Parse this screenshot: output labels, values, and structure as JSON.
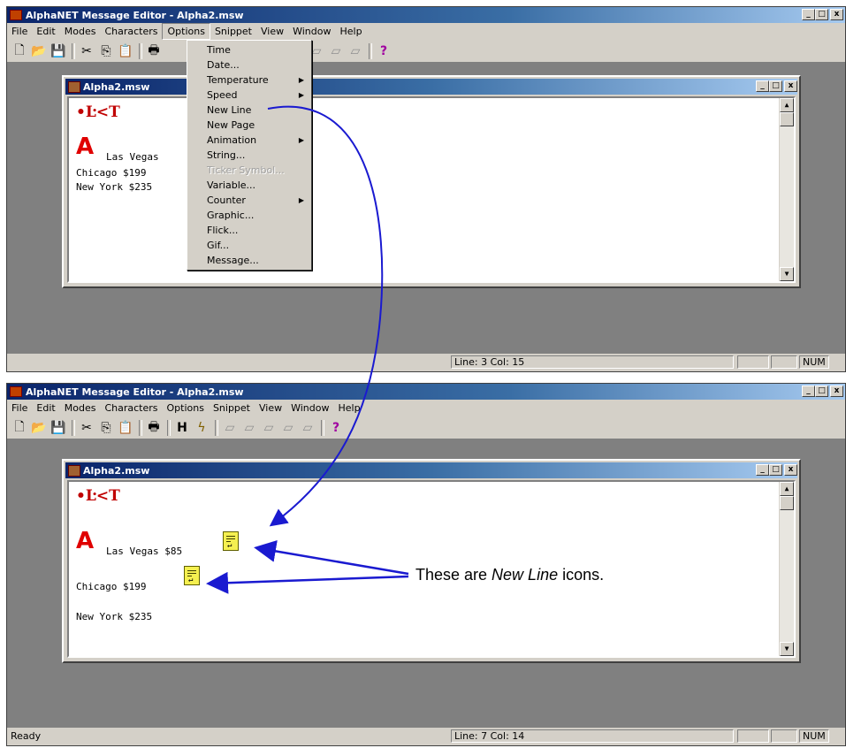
{
  "top_window": {
    "title": "AlphaNET Message Editor - Alpha2.msw",
    "controls": [
      "_",
      "□",
      "x"
    ],
    "menu": [
      "File",
      "Edit",
      "Modes",
      "Characters",
      "Options",
      "Snippet",
      "View",
      "Window",
      "Help"
    ],
    "open_menu": "Options",
    "child_title": "Alpha2.msw",
    "logo": "•Ŀ<T",
    "big_a": "A",
    "lines": [
      "Las Vegas",
      "Chicago $199",
      "New York $235"
    ],
    "status": {
      "ready": "",
      "position": "Line: 3  Col: 15",
      "num": "NUM"
    }
  },
  "dropdown": {
    "items": [
      {
        "label": "Time",
        "submenu": false,
        "disabled": false
      },
      {
        "label": "Date...",
        "submenu": false,
        "disabled": false
      },
      {
        "label": "Temperature",
        "submenu": true,
        "disabled": false
      },
      {
        "label": "Speed",
        "submenu": true,
        "disabled": false
      },
      {
        "label": "New Line",
        "submenu": false,
        "disabled": false
      },
      {
        "label": "New Page",
        "submenu": false,
        "disabled": false
      },
      {
        "label": "Animation",
        "submenu": true,
        "disabled": false
      },
      {
        "label": "String...",
        "submenu": false,
        "disabled": false
      },
      {
        "label": "Ticker Symbol...",
        "submenu": false,
        "disabled": true
      },
      {
        "label": "Variable...",
        "submenu": false,
        "disabled": false
      },
      {
        "label": "Counter",
        "submenu": true,
        "disabled": false
      },
      {
        "label": "Graphic...",
        "submenu": false,
        "disabled": false
      },
      {
        "label": "Flick...",
        "submenu": false,
        "disabled": false
      },
      {
        "label": "Gif...",
        "submenu": false,
        "disabled": false
      },
      {
        "label": "Message...",
        "submenu": false,
        "disabled": false
      }
    ]
  },
  "bottom_window": {
    "title": "AlphaNET Message Editor - Alpha2.msw",
    "menu": [
      "File",
      "Edit",
      "Modes",
      "Characters",
      "Options",
      "Snippet",
      "View",
      "Window",
      "Help"
    ],
    "child_title": "Alpha2.msw",
    "logo": "•Ŀ<T",
    "big_a": "A",
    "lines": [
      "Las Vegas $85",
      "Chicago $199",
      "New York $235"
    ],
    "status": {
      "ready": "Ready",
      "position": "Line: 7  Col: 14",
      "num": "NUM"
    }
  },
  "callout": {
    "prefix": "These are ",
    "emph": "New Line",
    "suffix": " icons."
  },
  "colors": {
    "title_start": "#0a246a",
    "title_end": "#a6caf0",
    "arrow": "#1a1ad0",
    "face": "#d4d0c8"
  }
}
